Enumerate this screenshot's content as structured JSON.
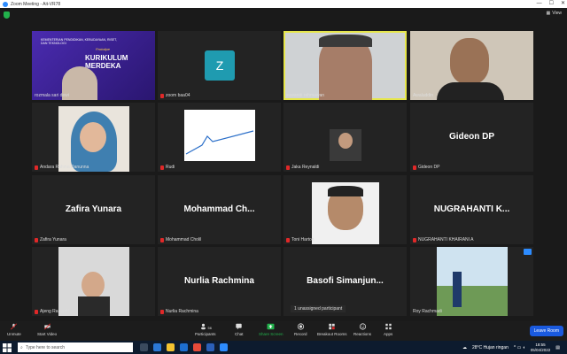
{
  "window": {
    "title": "Zoom Meeting - Ait-VR78"
  },
  "view_label": "View",
  "tiles": [
    {
      "name": "rozmala sari dewi",
      "big": "",
      "banner_top": "KEMENTERIAN PENDIDIKAN, KEBUDAYAAN, RISET, DAN TEKNOLOGI",
      "banner_main": "KURIKULUM MERDEKA",
      "banner_small": "Prototipe"
    },
    {
      "name": "zoom baa04",
      "avatar": "Z"
    },
    {
      "name": "suwandi rahmawan"
    },
    {
      "name": "Awaluddin"
    },
    {
      "name": "Andara Rahma Danunna"
    },
    {
      "name": "Rudi"
    },
    {
      "name": "Jaka Reynaldi"
    },
    {
      "name": "Gideon DP",
      "big": "Gideon DP"
    },
    {
      "name": "Zafira Yunara",
      "big": "Zafira Yunara"
    },
    {
      "name": "Mohammad Cholil",
      "big": "Mohammad  Ch..."
    },
    {
      "name": "Toni Harton"
    },
    {
      "name": "NUGRAHANTI KHAIRANI A",
      "big": "NUGRAHANTI  K..."
    },
    {
      "name": "Ajeng Rarasati"
    },
    {
      "name": "Nurlia Rachmina",
      "big": "Nurlia Rachmina"
    },
    {
      "name": "",
      "big": "Basofi  Simanjun...",
      "extra": "1 unassigned participant"
    },
    {
      "name": "Roy Rachmadi"
    }
  ],
  "toolbar": {
    "unmute": "Unmute",
    "start_video": "Start Video",
    "participants": "Participants",
    "participants_count": "56",
    "chat": "Chat",
    "share": "Share Screen",
    "record": "Record",
    "breakout": "Breakout Rooms",
    "reactions": "Reactions",
    "apps": "Apps",
    "leave": "Leave Room"
  },
  "taskbar": {
    "search_placeholder": "Type here to search",
    "weather": "28°C  Hujan ringan",
    "time": "18:55",
    "date": "05/04/2022"
  },
  "colors": {
    "accent": "#2d8cff",
    "share_green": "#22b14c",
    "leave_blue": "#1a5adf",
    "active_border": "#e6e64a"
  }
}
